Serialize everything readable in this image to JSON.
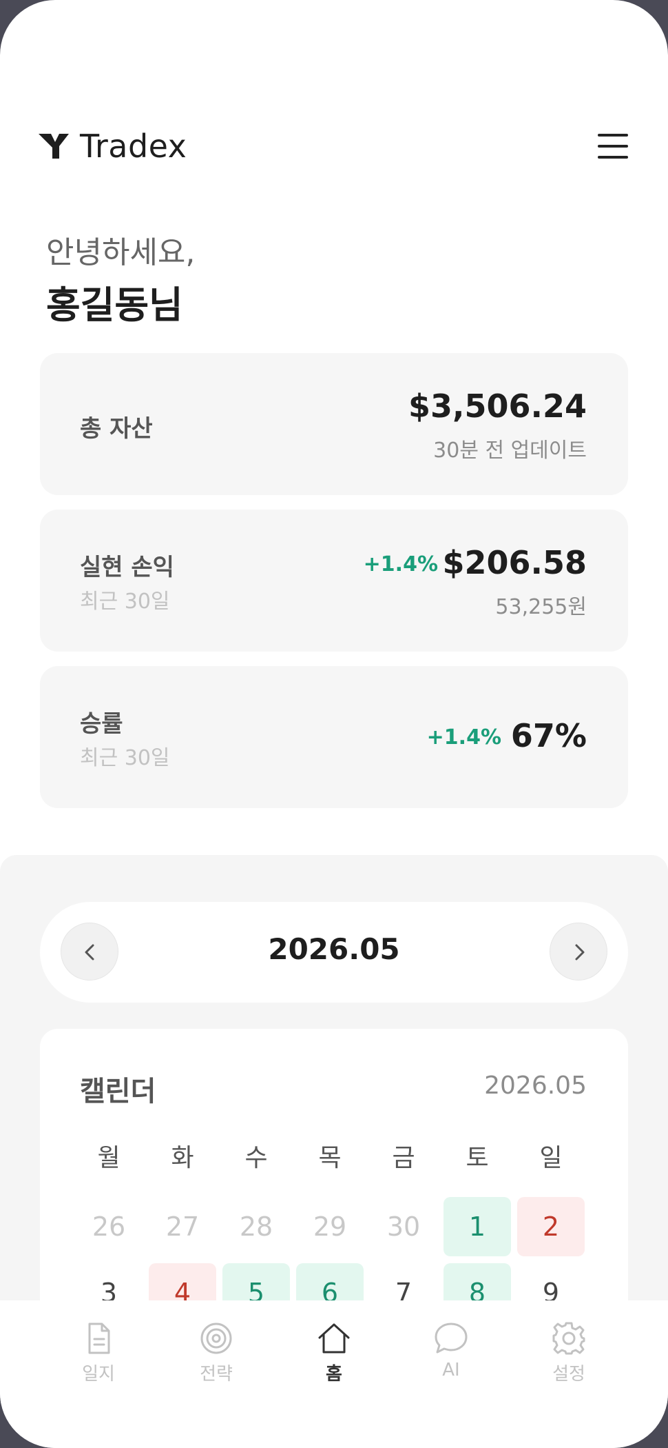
{
  "brand": {
    "name": "Tradex"
  },
  "greeting": {
    "line1": "안녕하세요,",
    "name": "홍길동님"
  },
  "summary": {
    "total_assets": {
      "label": "총 자산",
      "value": "$3,506.24",
      "note": "30분 전 업데이트"
    },
    "realized_pnl": {
      "label": "실현 손익",
      "period": "최근 30일",
      "change": "+1.4%",
      "value": "$206.58",
      "note": "53,255원"
    },
    "win_rate": {
      "label": "승률",
      "period": "최근 30일",
      "change": "+1.4%",
      "value": "67%"
    }
  },
  "month_nav": {
    "title": "2026.05"
  },
  "calendar": {
    "title": "캘린더",
    "month": "2026.05",
    "weekdays": [
      "월",
      "화",
      "수",
      "목",
      "금",
      "토",
      "일"
    ],
    "weeks": [
      [
        {
          "label": "26",
          "state": "muted"
        },
        {
          "label": "27",
          "state": "muted"
        },
        {
          "label": "28",
          "state": "muted"
        },
        {
          "label": "29",
          "state": "muted"
        },
        {
          "label": "30",
          "state": "muted"
        },
        {
          "label": "1",
          "state": "gain"
        },
        {
          "label": "2",
          "state": "loss"
        }
      ],
      [
        {
          "label": "3",
          "state": "none"
        },
        {
          "label": "4",
          "state": "loss"
        },
        {
          "label": "5",
          "state": "gain"
        },
        {
          "label": "6",
          "state": "gain"
        },
        {
          "label": "7",
          "state": "none"
        },
        {
          "label": "8",
          "state": "gain"
        },
        {
          "label": "9",
          "state": "none"
        }
      ]
    ]
  },
  "tabs": [
    {
      "label": "일지",
      "icon": "document-icon"
    },
    {
      "label": "전략",
      "icon": "target-icon"
    },
    {
      "label": "홈",
      "icon": "home-icon",
      "active": true
    },
    {
      "label": "AI",
      "icon": "chat-bubble-icon"
    },
    {
      "label": "설정",
      "icon": "gear-icon"
    }
  ],
  "colors": {
    "gain": "#1a9e7a",
    "loss": "#c0392b",
    "gain_bg": "#e3f7ef",
    "loss_bg": "#fdecec"
  }
}
